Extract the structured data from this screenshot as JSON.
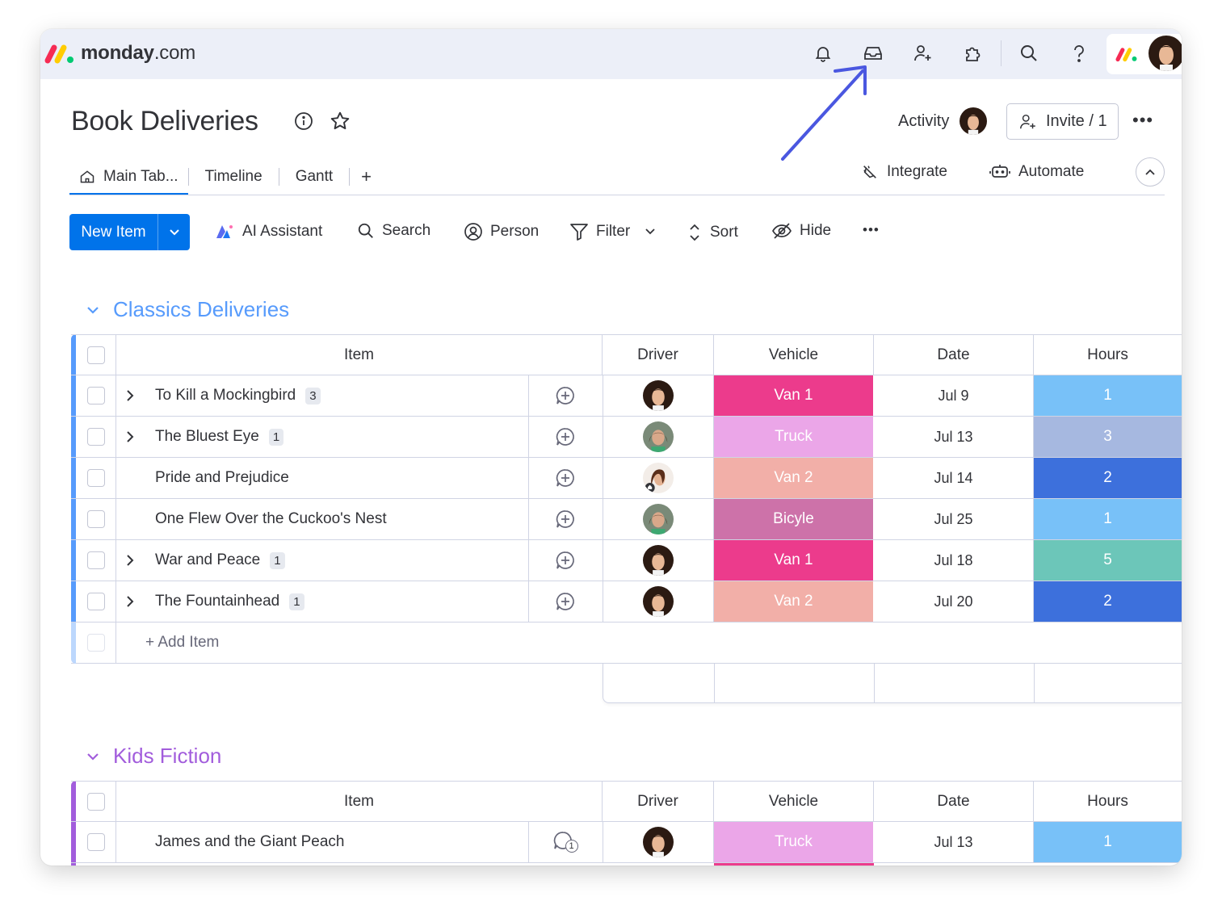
{
  "app": {
    "logo_bold": "monday",
    "logo_suffix": ".com"
  },
  "topbar": {
    "icons": [
      "bell-icon",
      "inbox-icon",
      "invite-members-icon",
      "apps-icon",
      "search-icon",
      "help-icon"
    ]
  },
  "board": {
    "title": "Book Deliveries",
    "activity_label": "Activity",
    "invite_label": "Invite / 1",
    "more_label": "•••"
  },
  "tabs": {
    "main": "Main Tab...",
    "timeline": "Timeline",
    "gantt": "Gantt",
    "add": "+"
  },
  "actions": {
    "integrate": "Integrate",
    "automate": "Automate"
  },
  "toolbar": {
    "new_item": "New Item",
    "ai_assistant": "AI Assistant",
    "search": "Search",
    "person": "Person",
    "filter": "Filter",
    "sort": "Sort",
    "hide": "Hide",
    "more": "•••"
  },
  "columns": {
    "item": "Item",
    "driver": "Driver",
    "vehicle": "Vehicle",
    "date": "Date",
    "hours": "Hours"
  },
  "colors": {
    "accent": "#0073ea",
    "group1": "#579bfc",
    "group2": "#a25ddc",
    "van1": "#ec3b8c",
    "truck": "#eba6e8",
    "van2": "#f2afa8",
    "bicycle": "#cd72a9",
    "hours_light": "#78c1f8",
    "hours_lavender": "#a6b8e0",
    "hours_blue": "#3d70dc",
    "hours_teal": "#6cc6b9",
    "annotation": "#4a57e0"
  },
  "groups": [
    {
      "title": "Classics Deliveries",
      "add_item": "+ Add Item",
      "rows": [
        {
          "name": "To Kill a Mockingbird",
          "count": "3",
          "expandable": true,
          "vehicle": "Van 1",
          "date": "Jul 9",
          "hours": "1"
        },
        {
          "name": "The Bluest Eye",
          "count": "1",
          "expandable": true,
          "vehicle": "Truck",
          "date": "Jul 13",
          "hours": "3"
        },
        {
          "name": "Pride and Prejudice",
          "count": "",
          "expandable": false,
          "vehicle": "Van 2",
          "date": "Jul 14",
          "hours": "2"
        },
        {
          "name": "One Flew Over the Cuckoo's Nest",
          "count": "",
          "expandable": false,
          "vehicle": "Bicyle",
          "date": "Jul 25",
          "hours": "1"
        },
        {
          "name": "War and Peace",
          "count": "1",
          "expandable": true,
          "vehicle": "Van 1",
          "date": "Jul 18",
          "hours": "5"
        },
        {
          "name": "The Fountainhead",
          "count": "1",
          "expandable": true,
          "vehicle": "Van 2",
          "date": "Jul 20",
          "hours": "2"
        }
      ]
    },
    {
      "title": "Kids Fiction",
      "rows": [
        {
          "name": "James and the Giant Peach",
          "count": "",
          "expandable": false,
          "vehicle": "Truck",
          "date": "Jul 13",
          "hours": "1",
          "comments": "1"
        }
      ]
    }
  ]
}
